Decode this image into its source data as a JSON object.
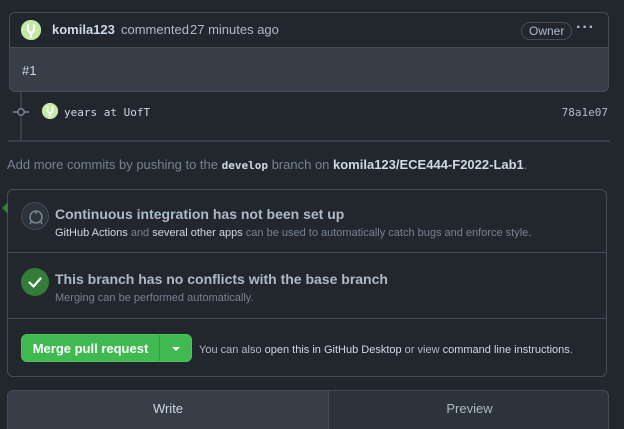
{
  "comment": {
    "author": "komila123",
    "action": "commented",
    "time": "27 minutes ago",
    "role_badge": "Owner",
    "body": "#1"
  },
  "commit": {
    "message": "years at UofT",
    "sha": "78a1e07"
  },
  "hint": {
    "prefix": "Add more commits by pushing to the ",
    "branch": "develop",
    "middle": " branch on ",
    "repo": "komila123/ECE444-F2022-Lab1",
    "suffix": "."
  },
  "checks": {
    "ci_title": "Continuous integration has not been set up",
    "ci_link1": "GitHub Actions",
    "ci_text1": " and ",
    "ci_link2": "several other apps",
    "ci_text2": " can be used to automatically catch bugs and enforce style.",
    "conflict_title": "This branch has no conflicts with the base branch",
    "conflict_sub": "Merging can be performed automatically."
  },
  "merge": {
    "button_label": "Merge pull request",
    "text1": "You can also ",
    "link1": "open this in GitHub Desktop",
    "text2": " or view ",
    "link2": "command line instructions",
    "text3": "."
  },
  "tabs": [
    "Write",
    "Preview"
  ],
  "colors": {
    "background": "#22272e",
    "panel": "#2d333b",
    "comment_body": "#373e47",
    "border": "#444c56",
    "success": "#347d39",
    "button_green": "#3fb950"
  }
}
